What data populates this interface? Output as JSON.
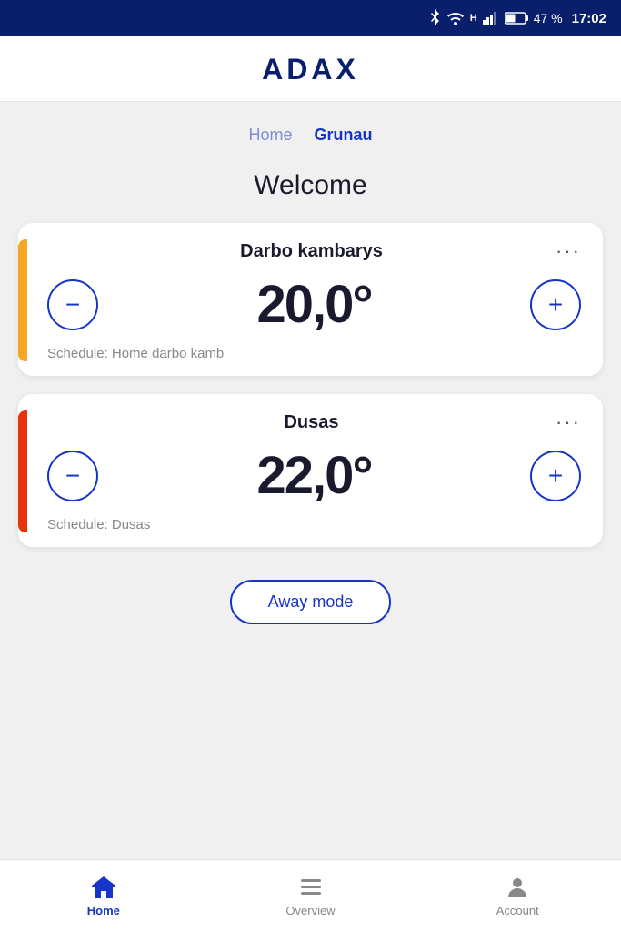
{
  "status_bar": {
    "battery": "47 %",
    "time": "17:02"
  },
  "header": {
    "logo": "ADAX"
  },
  "location_tabs": [
    {
      "label": "Home",
      "active": false
    },
    {
      "label": "Grunau",
      "active": true
    }
  ],
  "welcome": {
    "title": "Welcome"
  },
  "devices": [
    {
      "name": "Darbo kambarys",
      "temperature": "20,0°",
      "schedule": "Schedule: Home darbo kamb",
      "accent_color": "yellow",
      "more_label": "···"
    },
    {
      "name": "Dusas",
      "temperature": "22,0°",
      "schedule": "Schedule: Dusas",
      "accent_color": "red",
      "more_label": "···"
    }
  ],
  "away_mode": {
    "label": "Away mode"
  },
  "bottom_nav": [
    {
      "label": "Home",
      "active": true,
      "icon": "home"
    },
    {
      "label": "Overview",
      "active": false,
      "icon": "overview"
    },
    {
      "label": "Account",
      "active": false,
      "icon": "account"
    }
  ]
}
